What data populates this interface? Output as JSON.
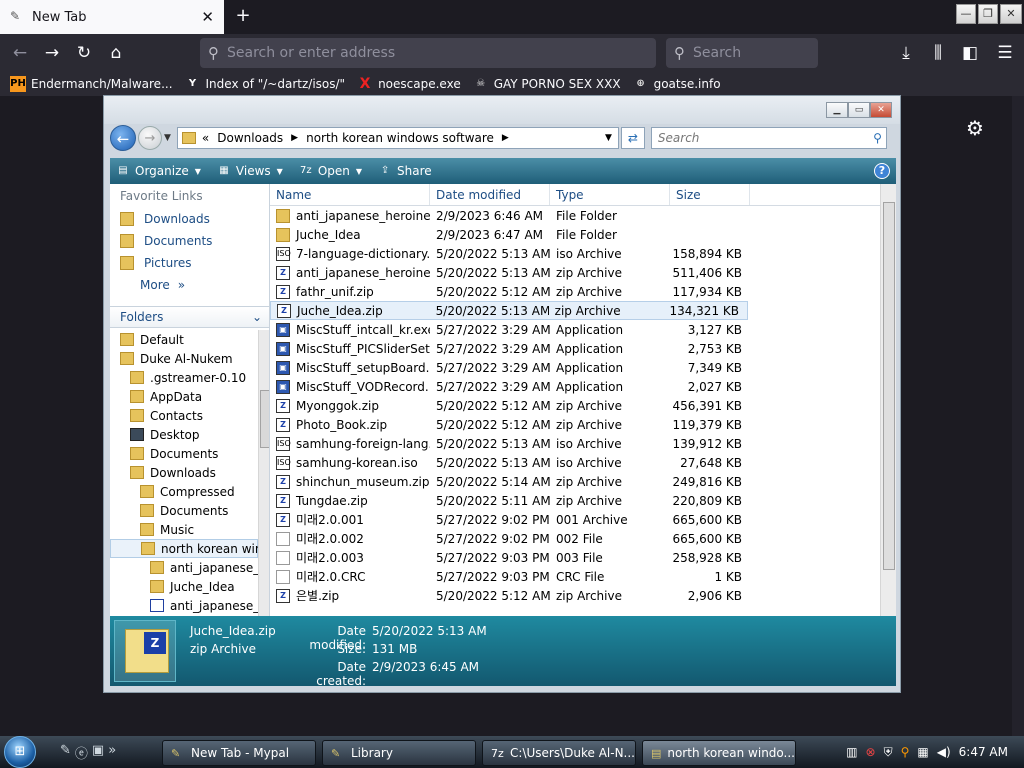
{
  "browser": {
    "tab_title": "New Tab",
    "tab_close": "✕",
    "new_tab": "+",
    "window_min": "—",
    "window_restore": "❐",
    "window_close": "✕",
    "url_placeholder": "Search or enter address",
    "search_placeholder": "Search",
    "bookmarks": [
      {
        "label": "Endermanch/Malware...",
        "icon": "PH"
      },
      {
        "label": "Index of \"/~dartz/isos/\"",
        "icon": "Y"
      },
      {
        "label": "noescape.exe",
        "icon": "X"
      },
      {
        "label": "GAY PORNO SEX XXX",
        "icon": "☠"
      },
      {
        "label": "goatse.info",
        "icon": "⊕"
      }
    ]
  },
  "explorer": {
    "breadcrumb_prefix": "«",
    "breadcrumb": [
      "Downloads",
      "north korean windows software"
    ],
    "search_placeholder": "Search",
    "toolbar": {
      "organize": "Organize",
      "views": "Views",
      "open": "Open",
      "share": "Share",
      "help": "?"
    },
    "nav": {
      "favorites_header": "Favorite Links",
      "favorites": [
        "Downloads",
        "Documents",
        "Pictures"
      ],
      "more": "More",
      "more_arrow": "»",
      "folders_header": "Folders",
      "tree": [
        {
          "label": "Default",
          "indent": 0,
          "icon": "folder"
        },
        {
          "label": "Duke Al-Nukem",
          "indent": 0,
          "icon": "folder"
        },
        {
          "label": ".gstreamer-0.10",
          "indent": 1,
          "icon": "folder"
        },
        {
          "label": "AppData",
          "indent": 1,
          "icon": "folder"
        },
        {
          "label": "Contacts",
          "indent": 1,
          "icon": "folder"
        },
        {
          "label": "Desktop",
          "indent": 1,
          "icon": "desktop"
        },
        {
          "label": "Documents",
          "indent": 1,
          "icon": "folder"
        },
        {
          "label": "Downloads",
          "indent": 1,
          "icon": "folder"
        },
        {
          "label": "Compressed",
          "indent": 2,
          "icon": "folder"
        },
        {
          "label": "Documents",
          "indent": 2,
          "icon": "folder"
        },
        {
          "label": "Music",
          "indent": 2,
          "icon": "folder"
        },
        {
          "label": "north korean wind",
          "indent": 2,
          "icon": "folder",
          "selected": true
        },
        {
          "label": "anti_japanese_he",
          "indent": 3,
          "icon": "folder"
        },
        {
          "label": "Juche_Idea",
          "indent": 3,
          "icon": "folder"
        },
        {
          "label": "anti_japanese_he",
          "indent": 3,
          "icon": "zip"
        }
      ]
    },
    "columns": [
      "Name",
      "Date modified",
      "Type",
      "Size"
    ],
    "files": [
      {
        "name": "anti_japanese_heroine",
        "date": "2/9/2023 6:46 AM",
        "type": "File Folder",
        "size": "",
        "icon": "folder"
      },
      {
        "name": "Juche_Idea",
        "date": "2/9/2023 6:47 AM",
        "type": "File Folder",
        "size": "",
        "icon": "folder"
      },
      {
        "name": "7-language-dictionary....",
        "date": "5/20/2022 5:13 AM",
        "type": "iso Archive",
        "size": "158,894 KB",
        "icon": "iso"
      },
      {
        "name": "anti_japanese_heroine....",
        "date": "5/20/2022 5:13 AM",
        "type": "zip Archive",
        "size": "511,406 KB",
        "icon": "zip"
      },
      {
        "name": "fathr_unif.zip",
        "date": "5/20/2022 5:12 AM",
        "type": "zip Archive",
        "size": "117,934 KB",
        "icon": "zip"
      },
      {
        "name": "Juche_Idea.zip",
        "date": "5/20/2022 5:13 AM",
        "type": "zip Archive",
        "size": "134,321 KB",
        "icon": "zip",
        "selected": true
      },
      {
        "name": "MiscStuff_intcall_kr.exe",
        "date": "5/27/2022 3:29 AM",
        "type": "Application",
        "size": "3,127 KB",
        "icon": "app"
      },
      {
        "name": "MiscStuff_PICSliderSet...",
        "date": "5/27/2022 3:29 AM",
        "type": "Application",
        "size": "2,753 KB",
        "icon": "app"
      },
      {
        "name": "MiscStuff_setupBoard....",
        "date": "5/27/2022 3:29 AM",
        "type": "Application",
        "size": "7,349 KB",
        "icon": "app"
      },
      {
        "name": "MiscStuff_VODRecord....",
        "date": "5/27/2022 3:29 AM",
        "type": "Application",
        "size": "2,027 KB",
        "icon": "app"
      },
      {
        "name": "Myonggok.zip",
        "date": "5/20/2022 5:12 AM",
        "type": "zip Archive",
        "size": "456,391 KB",
        "icon": "zip"
      },
      {
        "name": "Photo_Book.zip",
        "date": "5/20/2022 5:12 AM",
        "type": "zip Archive",
        "size": "119,379 KB",
        "icon": "zip"
      },
      {
        "name": "samhung-foreign-lang...",
        "date": "5/20/2022 5:13 AM",
        "type": "iso Archive",
        "size": "139,912 KB",
        "icon": "iso"
      },
      {
        "name": "samhung-korean.iso",
        "date": "5/20/2022 5:13 AM",
        "type": "iso Archive",
        "size": "27,648 KB",
        "icon": "iso"
      },
      {
        "name": "shinchun_museum.zip",
        "date": "5/20/2022 5:14 AM",
        "type": "zip Archive",
        "size": "249,816 KB",
        "icon": "zip"
      },
      {
        "name": "Tungdae.zip",
        "date": "5/20/2022 5:11 AM",
        "type": "zip Archive",
        "size": "220,809 KB",
        "icon": "zip"
      },
      {
        "name": "미래2.0.001",
        "date": "5/27/2022 9:02 PM",
        "type": "001 Archive",
        "size": "665,600 KB",
        "icon": "zip"
      },
      {
        "name": "미래2.0.002",
        "date": "5/27/2022 9:02 PM",
        "type": "002 File",
        "size": "665,600 KB",
        "icon": "blank"
      },
      {
        "name": "미래2.0.003",
        "date": "5/27/2022 9:03 PM",
        "type": "003 File",
        "size": "258,928 KB",
        "icon": "blank"
      },
      {
        "name": "미래2.0.CRC",
        "date": "5/27/2022 9:03 PM",
        "type": "CRC File",
        "size": "1 KB",
        "icon": "blank"
      },
      {
        "name": "은별.zip",
        "date": "5/20/2022 5:12 AM",
        "type": "zip Archive",
        "size": "2,906 KB",
        "icon": "zip"
      }
    ],
    "details": {
      "name": "Juche_Idea.zip",
      "type": "zip Archive",
      "date_modified_label": "Date modified:",
      "date_modified": "5/20/2022 5:13 AM",
      "size_label": "Size:",
      "size": "131 MB",
      "date_created_label": "Date created:",
      "date_created": "2/9/2023 6:45 AM"
    }
  },
  "taskbar": {
    "tasks": [
      "New Tab - Mypal",
      "Library",
      "C:\\Users\\Duke Al-N...",
      "north korean windo..."
    ],
    "time": "6:47 AM"
  },
  "colors": {
    "accent": "#1f5e78",
    "selection": "#e6f0fa",
    "folder": "#e6c35c"
  }
}
